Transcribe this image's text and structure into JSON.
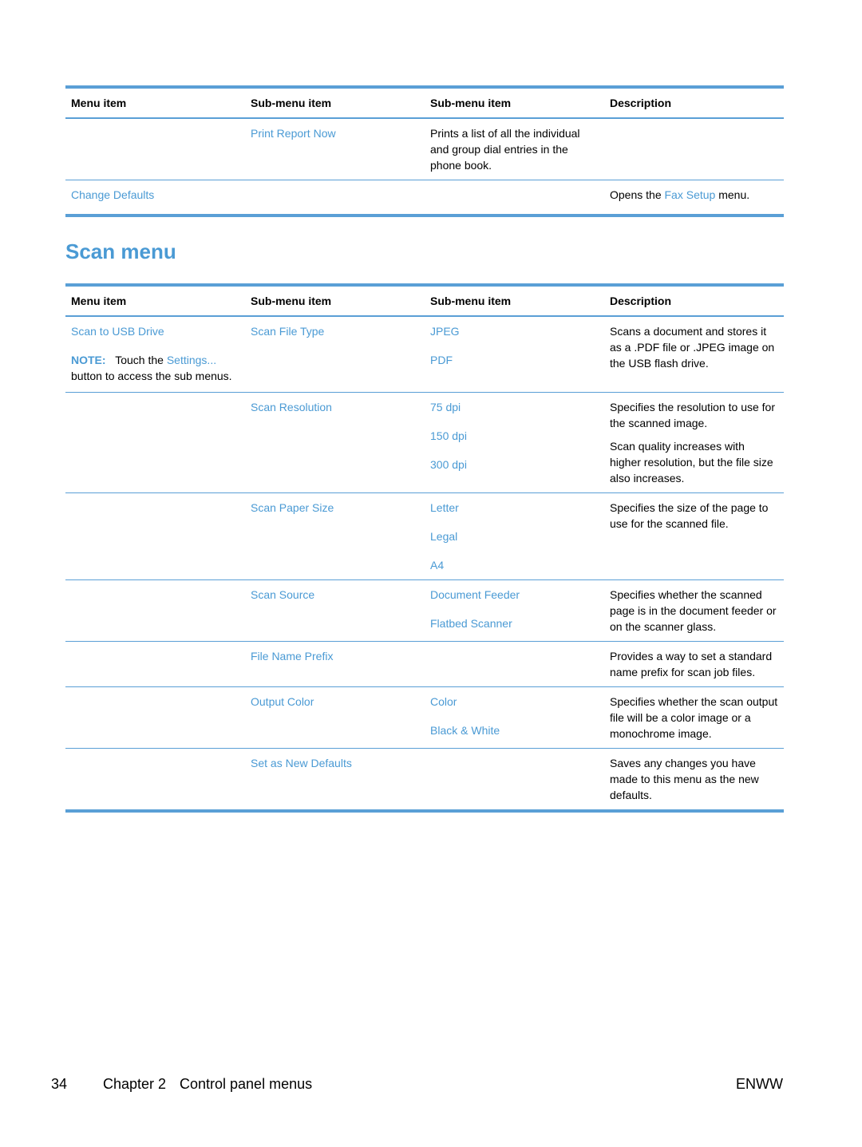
{
  "table1": {
    "headers": [
      "Menu item",
      "Sub-menu item",
      "Sub-menu item",
      "Description"
    ],
    "rows": [
      {
        "menu_item": "",
        "submenu": "Print Report Now",
        "subsubmenu": "Prints a list of all the individual and group dial entries in the phone book.",
        "description": ""
      },
      {
        "menu_item": "Change Defaults",
        "submenu": "",
        "subsubmenu": "",
        "description_prefix": "Opens the ",
        "description_link": "Fax Setup",
        "description_suffix": " menu."
      }
    ]
  },
  "section_title": "Scan menu",
  "table2": {
    "headers": [
      "Menu item",
      "Sub-menu item",
      "Sub-menu item",
      "Description"
    ],
    "first_row": {
      "menu_item": "Scan to USB Drive",
      "note_label": "NOTE:",
      "note_text_1": "Touch the ",
      "note_link": "Settings...",
      "note_text_2": "button to access the sub menus.",
      "submenu": "Scan File Type",
      "options": [
        "JPEG",
        "PDF"
      ],
      "description": [
        "Scans a document and stores it as a .PDF file or .JPEG image on the USB flash drive."
      ]
    },
    "rows": [
      {
        "submenu": "Scan Resolution",
        "options": [
          "75 dpi",
          "150 dpi",
          "300 dpi"
        ],
        "description": [
          "Specifies the resolution to use for the scanned image.",
          "Scan quality increases with higher resolution, but the file size also increases."
        ]
      },
      {
        "submenu": "Scan Paper Size",
        "options": [
          "Letter",
          "Legal",
          "A4"
        ],
        "description": [
          "Specifies the size of the page to use for the scanned file."
        ]
      },
      {
        "submenu": "Scan Source",
        "options": [
          "Document Feeder",
          "Flatbed Scanner"
        ],
        "description": [
          "Specifies whether the scanned page is in the document feeder or on the scanner glass."
        ]
      },
      {
        "submenu": "File Name Prefix",
        "options": [],
        "description": [
          "Provides a way to set a standard name prefix for scan job files."
        ]
      },
      {
        "submenu": "Output Color",
        "options": [
          "Color",
          "Black & White"
        ],
        "description": [
          "Specifies whether the scan output file will be a color image or a monochrome image."
        ]
      },
      {
        "submenu": "Set as New Defaults",
        "options": [],
        "description": [
          "Saves any changes you have made to this menu as the new defaults."
        ]
      }
    ]
  },
  "footer": {
    "page_number": "34",
    "chapter": "Chapter 2",
    "chapter_title": "Control panel menus",
    "locale": "ENWW"
  }
}
